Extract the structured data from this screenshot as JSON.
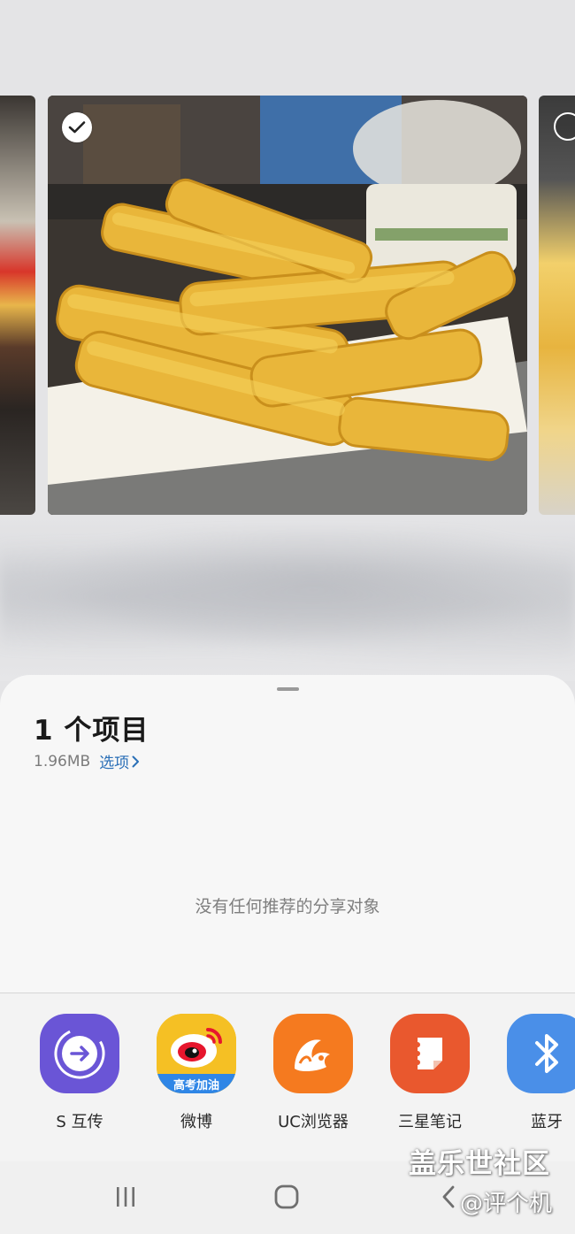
{
  "share_sheet": {
    "title": "1 个项目",
    "file_size": "1.96MB",
    "options_label": "选项",
    "empty_message": "没有任何推荐的分享对象"
  },
  "apps": [
    {
      "label": "S 互传",
      "icon": "quick-share-icon",
      "color": "#6a55d6"
    },
    {
      "label": "微博",
      "icon": "weibo-icon",
      "color": "#f5c024",
      "badge_text": "高考加油"
    },
    {
      "label": "UC浏览器",
      "icon": "uc-browser-icon",
      "color": "#f57a1f"
    },
    {
      "label": "三星笔记",
      "icon": "samsung-notes-icon",
      "color": "#e9582e"
    },
    {
      "label": "蓝牙",
      "icon": "bluetooth-icon",
      "color": "#4a8fe8"
    }
  ],
  "nav": {
    "recents": "recents-icon",
    "home": "home-icon",
    "back": "back-icon"
  },
  "watermark": {
    "line1": "盖乐世社区",
    "line2": "@评个机"
  }
}
